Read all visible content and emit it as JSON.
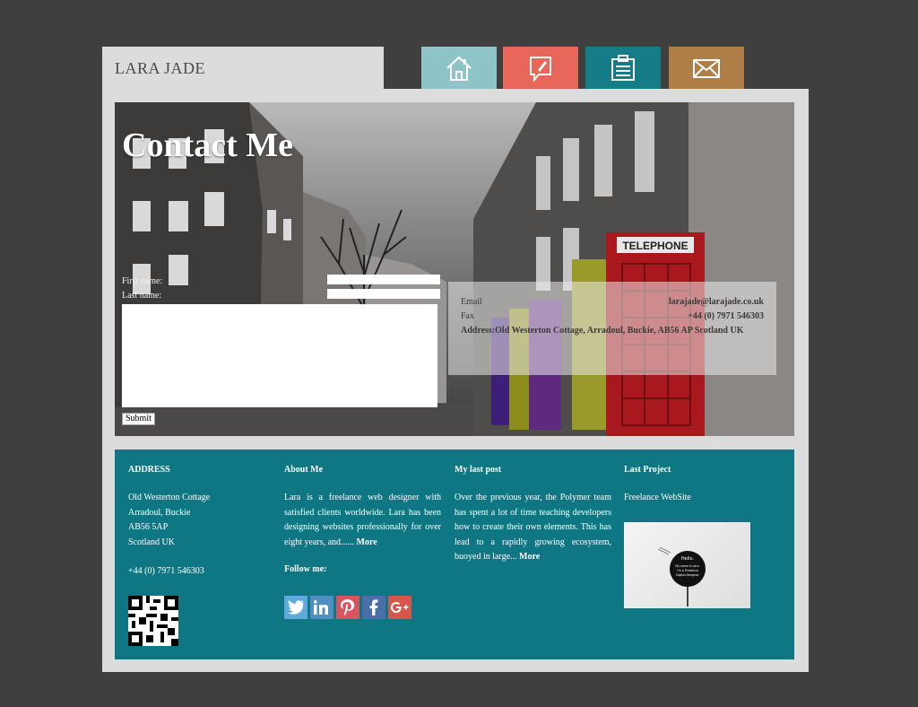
{
  "brand": {
    "name": "LARA JADE"
  },
  "nav": [
    {
      "icon": "home-icon",
      "color": "#8ec4c8"
    },
    {
      "icon": "blog-icon",
      "color": "#e8675a"
    },
    {
      "icon": "clipboard-icon",
      "color": "#157c88"
    },
    {
      "icon": "mail-icon",
      "color": "#b07f48"
    }
  ],
  "hero": {
    "title": "Contact Me",
    "form": {
      "first_label": "First name:",
      "last_label": "Last name:",
      "first_value": "",
      "last_value": "",
      "message_value": "",
      "submit": "Submit"
    },
    "contact": {
      "email_label": "Email",
      "email_value": "larajade@larajade.co.uk",
      "fax_label": "Fax",
      "fax_value": "+44 (0) 7971 546303",
      "address": "Address:Old Westerton Cottage, Arradoul, Buckie, AB56 AP Scotland UK"
    },
    "sign_text": "TELEPHONE"
  },
  "footer": {
    "address": {
      "heading": "ADDRESS",
      "lines": [
        "Old Westerton Cottage",
        "Arradoul, Buckie",
        "AB56 5AP",
        "Scotland UK"
      ],
      "phone": "+44 (0) 7971 546303"
    },
    "about": {
      "heading": "About Me",
      "text": "Lara is a freelance web designer with satisfied clients worldwide. Lara has been designing websites professionally for over eight years, and......",
      "more": "More",
      "follow": "Follow me:"
    },
    "last_post": {
      "heading": "My last post",
      "text": "Over the previous year, the Polymer team has spent a lot of time teaching developers how to create their own elements. This has lead to a rapidly growing ecosystem, buoyed in large...",
      "more": "More"
    },
    "last_project": {
      "heading": "Last Project",
      "name": "Freelance WebSite",
      "thumb_text": "Hello. My name is Lara. I'm a Freelance Digital Designer"
    },
    "social": [
      "twitter-icon",
      "linkedin-icon",
      "pinterest-icon",
      "facebook-icon",
      "google-plus-icon"
    ]
  },
  "colors": {
    "background": "#3f3f3f",
    "frame": "#dcdcdc",
    "footer": "#0f7784"
  }
}
